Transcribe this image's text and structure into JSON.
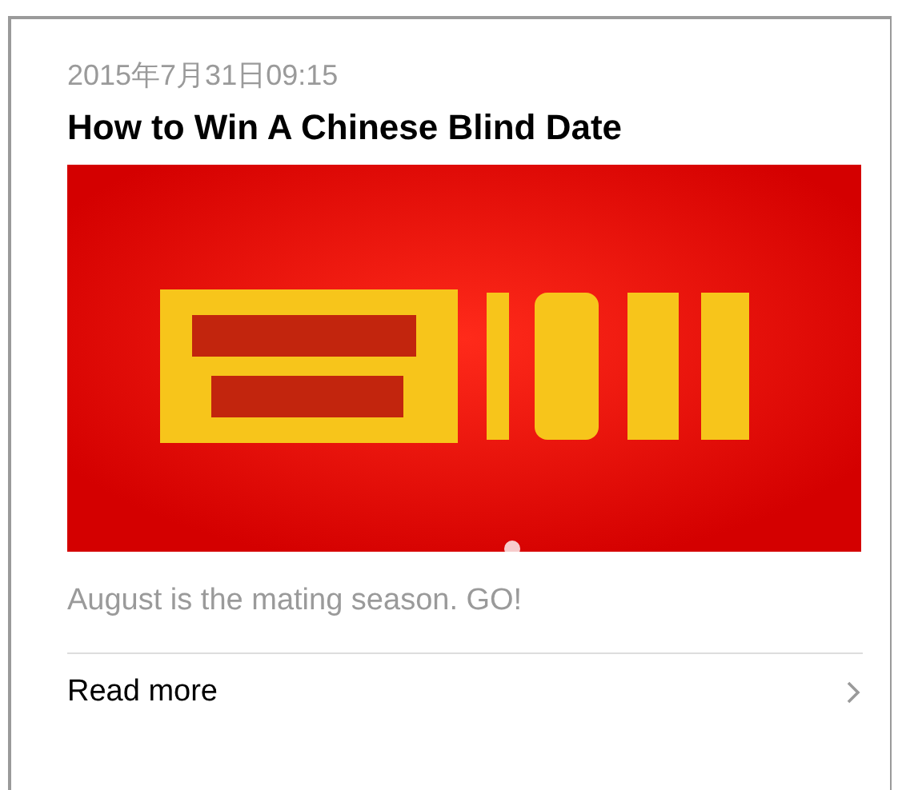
{
  "article": {
    "date": "2015年7月31日09:15",
    "title": "How to Win A Chinese Blind Date",
    "summary": "August is the mating season. GO!",
    "link": {
      "label": "Read more"
    }
  }
}
